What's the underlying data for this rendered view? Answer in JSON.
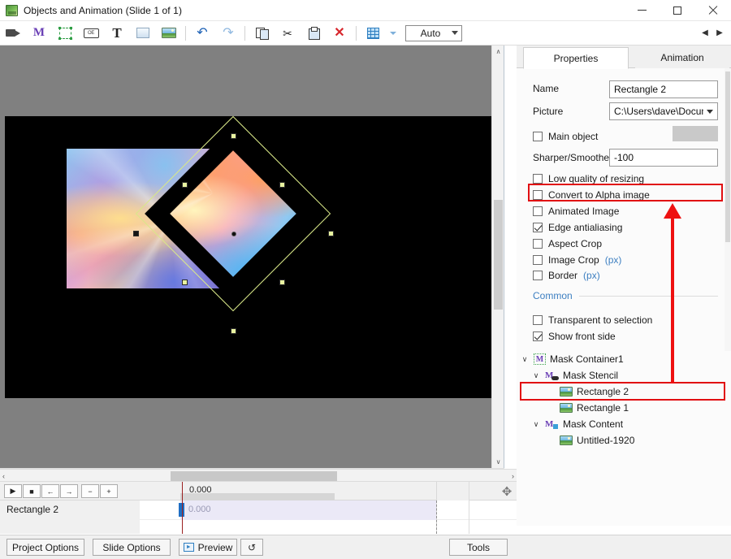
{
  "window": {
    "title": "Objects and Animation (Slide 1 of 1)",
    "app_icon": "app-icon",
    "minimize": "—",
    "maximize": "☐",
    "close": "×"
  },
  "toolbar": {
    "items": [
      {
        "name": "video-camera-icon",
        "label": ""
      },
      {
        "name": "mask-m-icon",
        "label": "M"
      },
      {
        "name": "frame-icon",
        "label": ""
      },
      {
        "name": "button-icon",
        "label": "OE"
      },
      {
        "name": "text-icon",
        "label": "T"
      },
      {
        "name": "rectangle-icon",
        "label": ""
      },
      {
        "name": "image-icon",
        "label": ""
      },
      {
        "name": "undo-icon",
        "label": "↶"
      },
      {
        "name": "redo-icon",
        "label": "↷"
      },
      {
        "name": "copy-icon",
        "label": ""
      },
      {
        "name": "cut-icon",
        "label": "✂"
      },
      {
        "name": "paste-icon",
        "label": ""
      },
      {
        "name": "delete-icon",
        "label": "✕"
      },
      {
        "name": "grid-icon",
        "label": ""
      }
    ],
    "zoom_value": "Auto",
    "nav_prev": "◀",
    "nav_next": "▶"
  },
  "canvas": {
    "background": "#808080",
    "slide_background": "#000000",
    "selection_color": "#d9e888",
    "vscroll_up": "∧",
    "vscroll_down": "∨",
    "hscroll_left": "‹",
    "hscroll_right": "›"
  },
  "right_panel": {
    "tabs": [
      {
        "label": "Properties",
        "active": true
      },
      {
        "label": "Animation",
        "active": false
      }
    ],
    "properties": {
      "name_label": "Name",
      "name_value": "Rectangle 2",
      "picture_label": "Picture",
      "picture_value": "C:\\Users\\dave\\Documen",
      "main_object_label": "Main object",
      "main_object_checked": false,
      "swatch_color": "#c9c9c9",
      "sharper_label": "Sharper/Smoother",
      "sharper_value": "-100",
      "checkboxes": [
        {
          "label": "Low quality of resizing",
          "checked": false,
          "suffix": ""
        },
        {
          "label": "Convert to Alpha image",
          "checked": false,
          "suffix": ""
        },
        {
          "label": "Animated Image",
          "checked": false,
          "suffix": ""
        },
        {
          "label": "Edge antialiasing",
          "checked": true,
          "suffix": ""
        },
        {
          "label": "Aspect Crop",
          "checked": false,
          "suffix": ""
        },
        {
          "label": "Image Crop",
          "checked": false,
          "suffix": "(px)"
        },
        {
          "label": "Border",
          "checked": false,
          "suffix": "(px)"
        }
      ],
      "common_section": "Common",
      "common_checkboxes": [
        {
          "label": "Transparent to selection",
          "checked": false
        },
        {
          "label": "Show front side",
          "checked": true
        }
      ]
    },
    "tree": [
      {
        "label": "Mask Container1",
        "icon": "mask-container-icon",
        "indent": 0,
        "caret": "∨",
        "selected": false
      },
      {
        "label": "Mask Stencil",
        "icon": "mask-stencil-icon",
        "indent": 1,
        "caret": "∨",
        "selected": false
      },
      {
        "label": "Rectangle 2",
        "icon": "image-layer-icon",
        "indent": 2,
        "caret": "",
        "selected": true
      },
      {
        "label": "Rectangle 1",
        "icon": "image-layer-icon",
        "indent": 2,
        "caret": "",
        "selected": false
      },
      {
        "label": "Mask Content",
        "icon": "mask-content-icon",
        "indent": 1,
        "caret": "∨",
        "selected": false
      },
      {
        "label": "Untitled-1920",
        "icon": "image-layer-icon",
        "indent": 2,
        "caret": "",
        "selected": false
      }
    ]
  },
  "annotations": {
    "highlight_color": "#e10f12",
    "arrow_color": "#ee1111",
    "highlight_1_target": "Convert to Alpha image",
    "highlight_2_target": "Rectangle 2"
  },
  "timeline": {
    "buttons": [
      {
        "name": "play-button",
        "glyph": "▶"
      },
      {
        "name": "stop-button",
        "glyph": "■"
      },
      {
        "name": "prev-keyframe-button",
        "glyph": "←"
      },
      {
        "name": "next-keyframe-button",
        "glyph": "→"
      },
      {
        "name": "zoom-out-button",
        "glyph": "−"
      },
      {
        "name": "zoom-in-button",
        "glyph": "+"
      }
    ],
    "ruler_time": "0.000",
    "track_name": "Rectangle 2",
    "keyframe_time": "0.000",
    "move_icon": "✥",
    "scroll_left": "‹",
    "scroll_right": "›"
  },
  "bottom_bar": {
    "project_options": "Project Options",
    "slide_options": "Slide Options",
    "preview": "Preview",
    "loop_icon": "↺",
    "tools": "Tools"
  }
}
